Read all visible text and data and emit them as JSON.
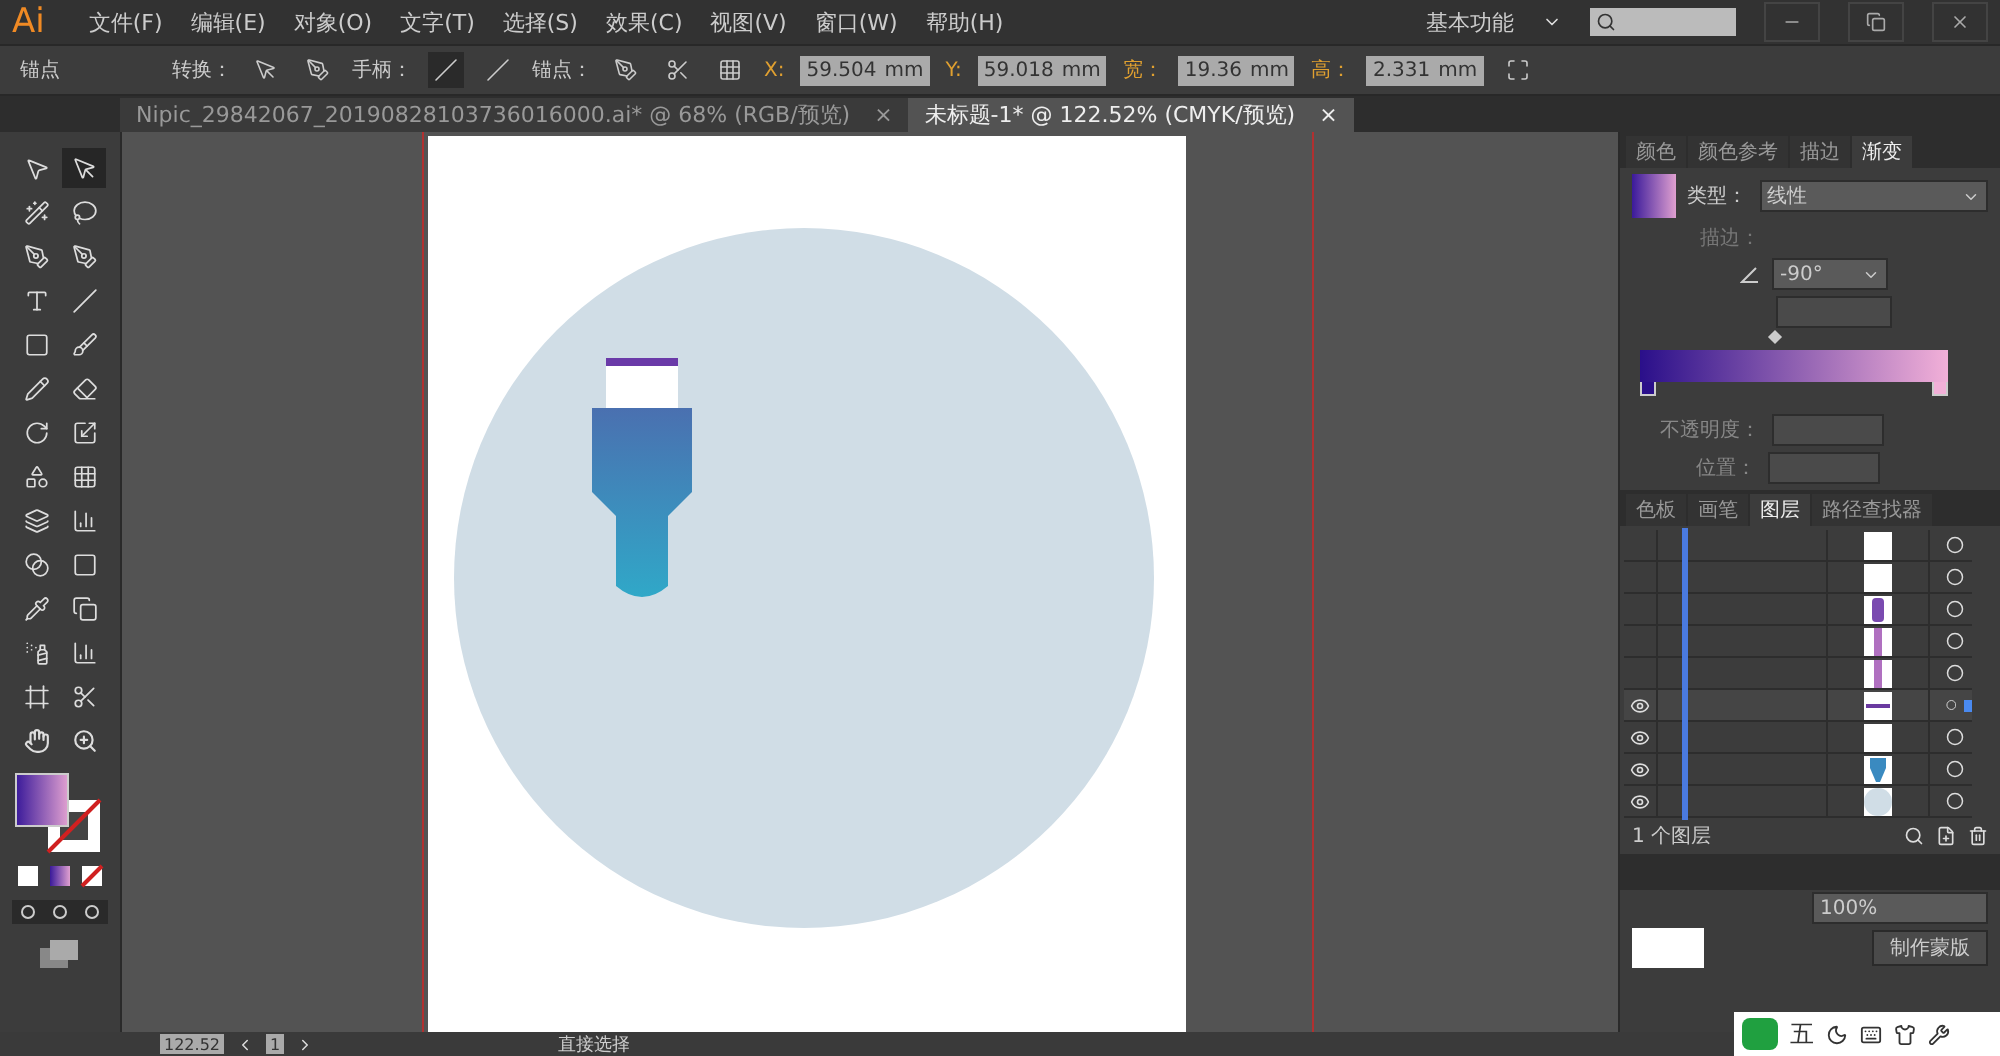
{
  "app": {
    "logo": "Ai",
    "menu": [
      "文件(F)",
      "编辑(E)",
      "对象(O)",
      "文字(T)",
      "选择(S)",
      "效果(C)",
      "视图(V)",
      "窗口(W)",
      "帮助(H)"
    ],
    "workspace": "基本功能"
  },
  "control_bar": {
    "label": "锚点",
    "convert": "转换：",
    "handles": "手柄：",
    "anchors": "锚点：",
    "fields": [
      {
        "label": "X:",
        "value": "59.504",
        "unit": "mm"
      },
      {
        "label": "Y:",
        "value": "59.018",
        "unit": "mm"
      },
      {
        "label": "宽：",
        "value": "19.36",
        "unit": "mm"
      },
      {
        "label": "高：",
        "value": "2.331",
        "unit": "mm"
      }
    ]
  },
  "doc_tabs": [
    {
      "label": "Nipic_29842067_20190828103736016000.ai* @ 68% (RGB/预览)",
      "close": "×",
      "selected": false
    },
    {
      "label": "未标题-1* @ 122.52% (CMYK/预览)",
      "close": "×",
      "selected": true
    }
  ],
  "tools": [
    {
      "selected": false
    },
    {
      "selected": true
    },
    {
      "selected": false
    },
    {
      "selected": false
    },
    {
      "selected": false
    },
    {
      "selected": false
    },
    {
      "selected": false
    },
    {
      "selected": false
    },
    {
      "selected": false
    },
    {
      "selected": false
    },
    {
      "selected": false
    },
    {
      "selected": false
    },
    {
      "selected": false
    },
    {
      "selected": false
    },
    {
      "selected": false
    },
    {
      "selected": false
    },
    {
      "selected": false
    },
    {
      "selected": false
    },
    {
      "selected": false
    },
    {
      "selected": false
    },
    {
      "selected": false
    },
    {
      "selected": false
    },
    {
      "selected": false
    },
    {
      "selected": false
    },
    {
      "selected": false
    },
    {
      "selected": false
    }
  ],
  "gradient_panel": {
    "tabs": [
      {
        "label": "颜色",
        "selected": false
      },
      {
        "label": "颜色参考",
        "selected": false
      },
      {
        "label": "描边",
        "selected": false
      },
      {
        "label": "渐变",
        "selected": true
      }
    ],
    "stops": [
      {
        "color": "#2a0f8a"
      },
      {
        "color": "#f2b0d8"
      }
    ],
    "midpoint": {
      "level": 0.44
    },
    "type_label": "类型：",
    "type_value": "线性",
    "stroke_label": "描边：",
    "angle": "-90°",
    "opacity_label": "不透明度：",
    "location_label": "位置："
  },
  "layers_panel": {
    "tabs": [
      {
        "label": "色板",
        "selected": false
      },
      {
        "label": "画笔",
        "selected": false
      },
      {
        "label": "图层",
        "selected": true
      },
      {
        "label": "路径查找器",
        "selected": false
      }
    ],
    "rows": [
      {
        "visible": false,
        "kind": "blank",
        "selected": false
      },
      {
        "visible": false,
        "kind": "blank",
        "selected": false
      },
      {
        "visible": false,
        "kind": "pen",
        "selected": false
      },
      {
        "visible": false,
        "kind": "bar",
        "selected": false
      },
      {
        "visible": false,
        "kind": "bar",
        "selected": false
      },
      {
        "visible": true,
        "kind": "line",
        "selected": true
      },
      {
        "visible": true,
        "kind": "blank",
        "selected": false
      },
      {
        "visible": true,
        "kind": "nib",
        "selected": false
      },
      {
        "visible": true,
        "kind": "circle",
        "selected": false
      }
    ],
    "count": "1 个图层"
  },
  "transparency_panel": {
    "opacity": "100%",
    "mask_button": "制作蒙版"
  },
  "status_bar": {
    "zoom": "122.52",
    "page": "1",
    "tool": "直接选择"
  },
  "ime": {
    "label": "五"
  }
}
